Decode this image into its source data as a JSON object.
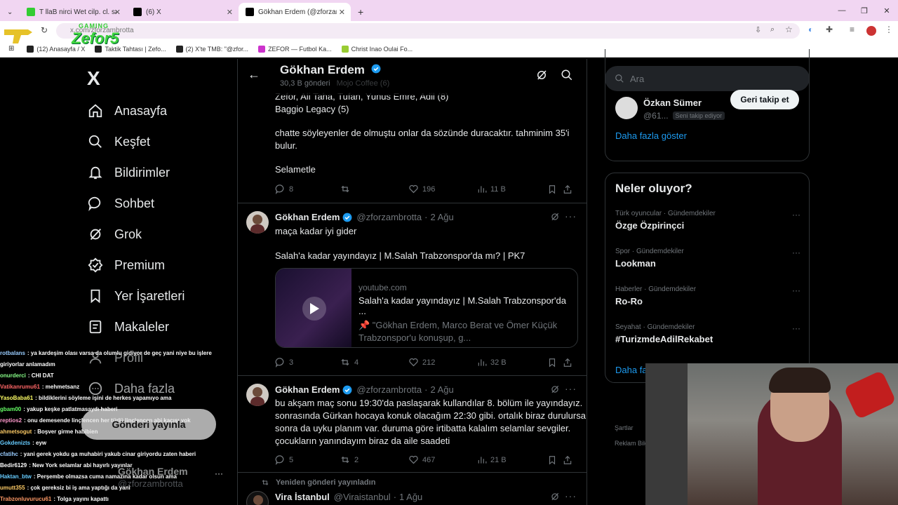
{
  "browser": {
    "tabs": [
      {
        "label": "T  llaB  nirci  Wet cilp. cl. sa"
      },
      {
        "label": "(6) X"
      },
      {
        "label": "Gökhan Erdem (@zforzambrotta)"
      }
    ],
    "new_tab": "+",
    "url": "x.com/zforzambrotta",
    "bookmarks": [
      "(12) Anasayfa / X",
      "Taktik Tahtası | Zefo...",
      "(2) X'te TMB: \"@zfor...",
      "ZEFOR — Futbol Ka...",
      "Christ Inao Oulai Fo..."
    ]
  },
  "overlay": {
    "logo_top": "GAMING",
    "logo_text": "Zefor5"
  },
  "nav": {
    "logo": "X",
    "items": [
      {
        "label": "Anasayfa",
        "icon": "home-icon"
      },
      {
        "label": "Keşfet",
        "icon": "search-icon"
      },
      {
        "label": "Bildirimler",
        "icon": "bell-icon"
      },
      {
        "label": "Sohbet",
        "icon": "chat-icon"
      },
      {
        "label": "Grok",
        "icon": "grok-icon"
      },
      {
        "label": "Premium",
        "icon": "premium-icon"
      },
      {
        "label": "Yer İşaretleri",
        "icon": "bookmark-icon"
      },
      {
        "label": "Makaleler",
        "icon": "article-icon"
      },
      {
        "label": "Profil",
        "icon": "profile-icon"
      },
      {
        "label": "Daha fazla",
        "icon": "more-icon"
      }
    ],
    "post_button": "Gönderi yayınla",
    "account_name": "Gökhan Erdem",
    "account_handle": "@zforzambrotta"
  },
  "header": {
    "name": "Gökhan Erdem",
    "post_count": "30,3 B gönderi",
    "behind_text": "Mojo Coffee (6)"
  },
  "tweets": [
    {
      "lines": [
        "Zefor, Ali Taha, Tufan, Yunus Emre, Adil (8)",
        "Baggio Legacy (5)",
        "",
        "chatte söyleyenler de olmuştu onlar da sözünde duracaktır. tahminim 35'i",
        "bulur.",
        "",
        "Selametle"
      ],
      "replies": "8",
      "reposts": "",
      "likes": "196",
      "views": "11 B"
    },
    {
      "name": "Gökhan Erdem",
      "handle": "@zforzambrotta",
      "date": "2 Ağu",
      "text1": "maça kadar iyi gider",
      "text2": "Salah'a kadar yayındayız | M.Salah Trabzonspor'da mı? | PK7",
      "card": {
        "domain": "youtube.com",
        "title": "Salah'a kadar yayındayız | M.Salah Trabzonspor'da ...",
        "desc1": "📌 \"Gökhan Erdem, Marco Berat ve Ömer Küçük",
        "desc2": "Trabzonspor'u konuşup, g..."
      },
      "replies": "3",
      "reposts": "4",
      "likes": "212",
      "views": "32 B"
    },
    {
      "name": "Gökhan Erdem",
      "handle": "@zforzambrotta",
      "date": "2 Ağu",
      "lines": [
        "bu akşam maç sonu 19:30'da paslaşarak kullandılar 8. bölüm ile yayındayız.",
        "sonrasında Gürkan hocaya konuk olacağım 22:30 gibi. ortalık biraz durulursa",
        "sonra da uyku planım var. duruma göre irtibatta kalalım selamlar sevgiler.",
        "çocukların yanındayım biraz da aile saadeti"
      ],
      "replies": "5",
      "reposts": "2",
      "likes": "467",
      "views": "21 B"
    },
    {
      "repost_label": "Yeniden gönderi yayınladın",
      "name": "Vira İstanbul",
      "handle": "@Viraistanbul",
      "date": "1 Ağu"
    }
  ],
  "right": {
    "search_placeholder": "Ara",
    "who_to_follow": {
      "name": "Özkan Sümer",
      "handle": "@61...",
      "badge": "Seni takip ediyor",
      "button": "Geri takip et",
      "show_more": "Daha fazla göster"
    },
    "trends_title": "Neler oluyor?",
    "trends": [
      {
        "category": "Türk oyuncular · Gündemdekiler",
        "title": "Özge Özpirinçci"
      },
      {
        "category": "Spor · Gündemdekiler",
        "title": "Lookman"
      },
      {
        "category": "Haberler · Gündemdekiler",
        "title": "Ro-Ro"
      },
      {
        "category": "Seyahat · Gündemdekiler",
        "title": "#TurizmdeAdilRekabet"
      }
    ],
    "trends_more": "Daha fazla göster",
    "footer1": "Şartlar",
    "footer2": "Reklam Bilgi"
  },
  "chat": [
    {
      "user": "rotbalans",
      "color": "#9cf",
      "text": ": ya kardeşim olası varsa da olumlu gidiyor de geç yani niye bu işlere"
    },
    {
      "user": "",
      "color": "#fff",
      "text": "giriyorlar anlamadım"
    },
    {
      "user": "onurderci",
      "color": "#8f8",
      "text": ": CHI DAT"
    },
    {
      "user": "Vatikanrumu61",
      "color": "#f66",
      "text": ": mehmetsanz"
    },
    {
      "user": "YasoBaba61",
      "color": "#ff6",
      "text": ": bildiklerini söyleme işini de herkes yapamıyo ama"
    },
    {
      "user": "gbam00",
      "color": "#6f6",
      "text": ": yakup keşke patlatmasaydı haberi"
    },
    {
      "user": "reptios2",
      "color": "#f9c",
      "text": ": onu demesende linçlencen her türlü linçlencen abi kaçışı yok"
    },
    {
      "user": "ahmetsogut",
      "color": "#fc6",
      "text": ": Boşver girme habibien"
    },
    {
      "user": "Gokdenizts",
      "color": "#6cf",
      "text": ": eyw"
    },
    {
      "user": "cfatihc",
      "color": "#9cf",
      "text": ": yani gerek yokdu ga muhabiri yakub cinar giriyordu zaten haberi"
    },
    {
      "user": "Bedir6129",
      "color": "#fff",
      "text": ": New York selamlar abi hayırlı yayınlar"
    },
    {
      "user": "Haktan_btw",
      "color": "#6cf",
      "text": ": Perşembe olmazsa cuma namazına kadar olsun ama"
    },
    {
      "user": "umutt355",
      "color": "#fc6",
      "text": ": çok gereksiz bi iş ama yaptığı da yani"
    },
    {
      "user": "Trabzonluvurucu61",
      "color": "#f96",
      "text": ": Tolga yayını kapattı"
    }
  ]
}
